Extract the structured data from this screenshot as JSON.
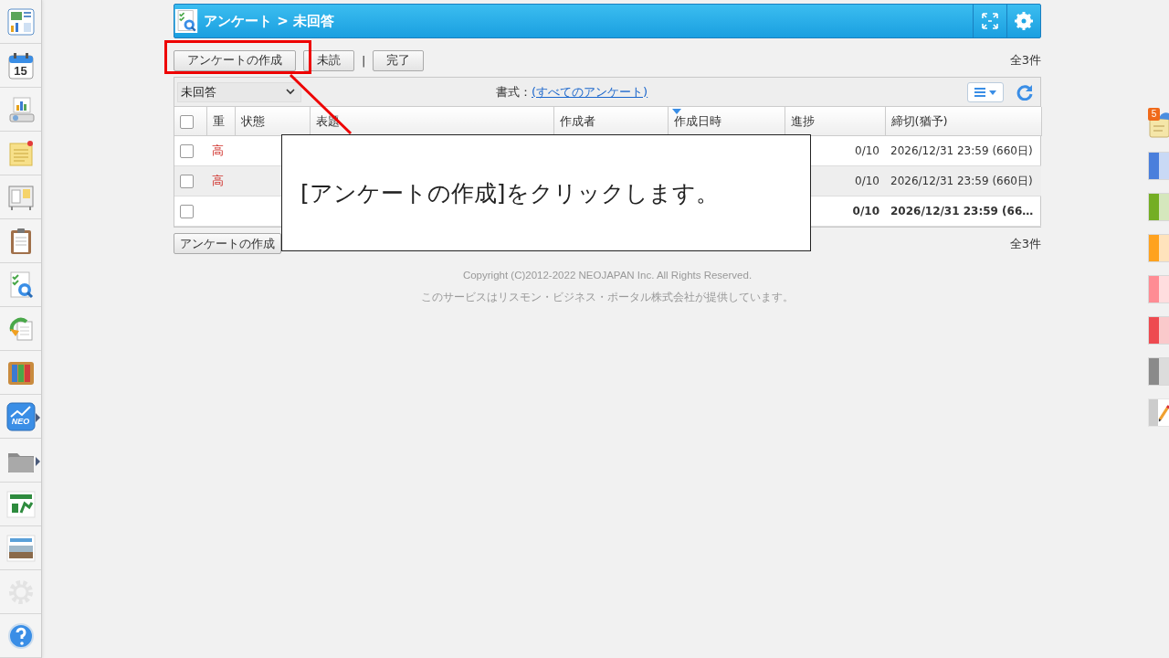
{
  "sidebar": {
    "items": [
      {
        "kind": "dashboard",
        "arrow": false,
        "disabled": false
      },
      {
        "kind": "calendar",
        "text": "15",
        "arrow": false,
        "disabled": false
      },
      {
        "kind": "projector",
        "arrow": false,
        "disabled": false
      },
      {
        "kind": "memo",
        "arrow": false,
        "disabled": false
      },
      {
        "kind": "board",
        "arrow": false,
        "disabled": false
      },
      {
        "kind": "clipboard",
        "arrow": false,
        "disabled": false
      },
      {
        "kind": "survey",
        "arrow": false,
        "disabled": false
      },
      {
        "kind": "sync",
        "arrow": false,
        "disabled": false
      },
      {
        "kind": "binders",
        "arrow": false,
        "disabled": false
      },
      {
        "kind": "neo",
        "text": "NEO",
        "arrow": true,
        "disabled": false
      },
      {
        "kind": "folder",
        "arrow": true,
        "disabled": false
      },
      {
        "kind": "logo",
        "arrow": false,
        "disabled": false
      },
      {
        "kind": "banner",
        "arrow": false,
        "disabled": false
      },
      {
        "kind": "gear",
        "arrow": false,
        "disabled": true
      },
      {
        "kind": "help",
        "arrow": false,
        "disabled": false
      }
    ]
  },
  "header": {
    "title": "アンケート > 未回答"
  },
  "toolbar": {
    "buttons": [
      "アンケートの作成",
      "未読",
      "完了"
    ],
    "separator": "|",
    "count": "全3件"
  },
  "filter": {
    "value": "未回答",
    "format_label": "書式：",
    "format_link": "(すべてのアンケート)"
  },
  "table": {
    "select_all_checked": false,
    "columns": [
      {
        "label": "重",
        "sorted": false
      },
      {
        "label": "状態",
        "sorted": false
      },
      {
        "label": "表題",
        "sorted": false
      },
      {
        "label": "作成者",
        "sorted": false
      },
      {
        "label": "作成日時",
        "sorted": true
      },
      {
        "label": "進捗",
        "sorted": false
      },
      {
        "label": "締切(猶予)",
        "sorted": false
      }
    ],
    "rows": [
      {
        "checked": false,
        "priority": "高",
        "progress": "0/10",
        "deadline": "2026/12/31 23:59 (660日)",
        "unread": false
      },
      {
        "checked": false,
        "priority": "高",
        "progress": "0/10",
        "deadline": "2026/12/31 23:59 (660日)",
        "unread": false
      },
      {
        "checked": false,
        "progress": "0/10",
        "deadline": "2026/12/31 23:59 (66…",
        "unread": true
      }
    ]
  },
  "bottom_toolbar": {
    "button": "アンケートの作成",
    "count": "全3件"
  },
  "footer": [
    "Copyright (C)2012-2022 NEOJAPAN Inc. All Rights Reserved.",
    "このサービスはリスモン・ビジネス・ポータル株式会社が提供しています。"
  ],
  "callout": {
    "text": "[アンケートの作成]をクリックします。"
  },
  "right_panel": {
    "badge": "5",
    "tabs": [
      {
        "color": "#4a7fdc"
      },
      {
        "color": "#74ae24"
      },
      {
        "color": "#ffa21f"
      },
      {
        "color": "#ff8c94"
      },
      {
        "color": "#ee4a50"
      },
      {
        "color": "#8a8a8a"
      }
    ]
  }
}
